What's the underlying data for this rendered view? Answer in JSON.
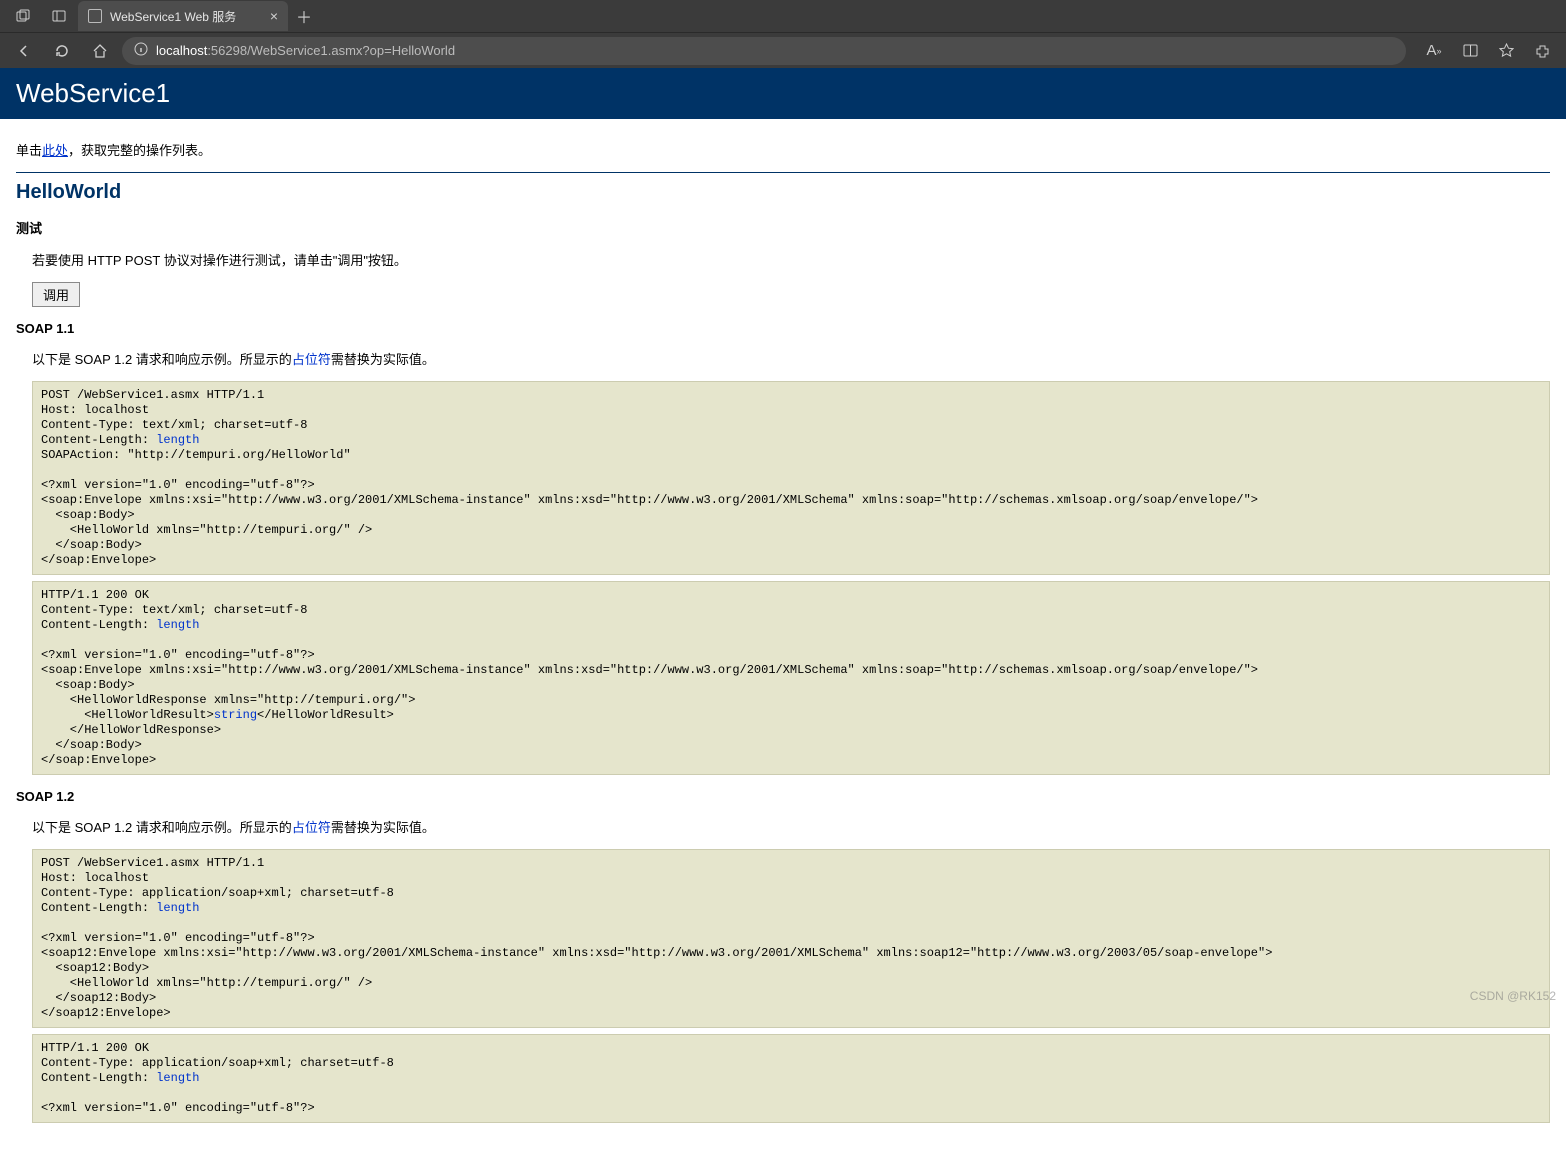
{
  "browser": {
    "tab_title": "WebService1 Web 服务",
    "url_host": "localhost",
    "url_rest": ":56298/WebService1.asmx?op=HelloWorld"
  },
  "page": {
    "title": "WebService1",
    "intro_prefix": "单击",
    "intro_link": "此处",
    "intro_suffix": "，获取完整的操作列表。",
    "operation": "HelloWorld",
    "test_heading": "测试",
    "test_desc": "若要使用 HTTP POST 协议对操作进行测试，请单击\"调用\"按钮。",
    "invoke_label": "调用",
    "soap11_heading": "SOAP 1.1",
    "soap_desc_prefix": "以下是 SOAP 1.2 请求和响应示例。所显示的",
    "soap_desc_placeholder": "占位符",
    "soap_desc_suffix": "需替换为实际值。",
    "soap12_heading": "SOAP 1.2",
    "placeholder_length": "length",
    "placeholder_string": "string",
    "code": {
      "soap11_req_a": "POST /WebService1.asmx HTTP/1.1\nHost: localhost\nContent-Type: text/xml; charset=utf-8\nContent-Length: ",
      "soap11_req_b": "\nSOAPAction: \"http://tempuri.org/HelloWorld\"\n\n<?xml version=\"1.0\" encoding=\"utf-8\"?>\n<soap:Envelope xmlns:xsi=\"http://www.w3.org/2001/XMLSchema-instance\" xmlns:xsd=\"http://www.w3.org/2001/XMLSchema\" xmlns:soap=\"http://schemas.xmlsoap.org/soap/envelope/\">\n  <soap:Body>\n    <HelloWorld xmlns=\"http://tempuri.org/\" />\n  </soap:Body>\n</soap:Envelope>",
      "soap11_res_a": "HTTP/1.1 200 OK\nContent-Type: text/xml; charset=utf-8\nContent-Length: ",
      "soap11_res_b": "\n\n<?xml version=\"1.0\" encoding=\"utf-8\"?>\n<soap:Envelope xmlns:xsi=\"http://www.w3.org/2001/XMLSchema-instance\" xmlns:xsd=\"http://www.w3.org/2001/XMLSchema\" xmlns:soap=\"http://schemas.xmlsoap.org/soap/envelope/\">\n  <soap:Body>\n    <HelloWorldResponse xmlns=\"http://tempuri.org/\">\n      <HelloWorldResult>",
      "soap11_res_c": "</HelloWorldResult>\n    </HelloWorldResponse>\n  </soap:Body>\n</soap:Envelope>",
      "soap12_req_a": "POST /WebService1.asmx HTTP/1.1\nHost: localhost\nContent-Type: application/soap+xml; charset=utf-8\nContent-Length: ",
      "soap12_req_b": "\n\n<?xml version=\"1.0\" encoding=\"utf-8\"?>\n<soap12:Envelope xmlns:xsi=\"http://www.w3.org/2001/XMLSchema-instance\" xmlns:xsd=\"http://www.w3.org/2001/XMLSchema\" xmlns:soap12=\"http://www.w3.org/2003/05/soap-envelope\">\n  <soap12:Body>\n    <HelloWorld xmlns=\"http://tempuri.org/\" />\n  </soap12:Body>\n</soap12:Envelope>",
      "soap12_res_a": "HTTP/1.1 200 OK\nContent-Type: application/soap+xml; charset=utf-8\nContent-Length: ",
      "soap12_res_b": "\n\n<?xml version=\"1.0\" encoding=\"utf-8\"?>"
    }
  },
  "watermark": "CSDN @RK152"
}
